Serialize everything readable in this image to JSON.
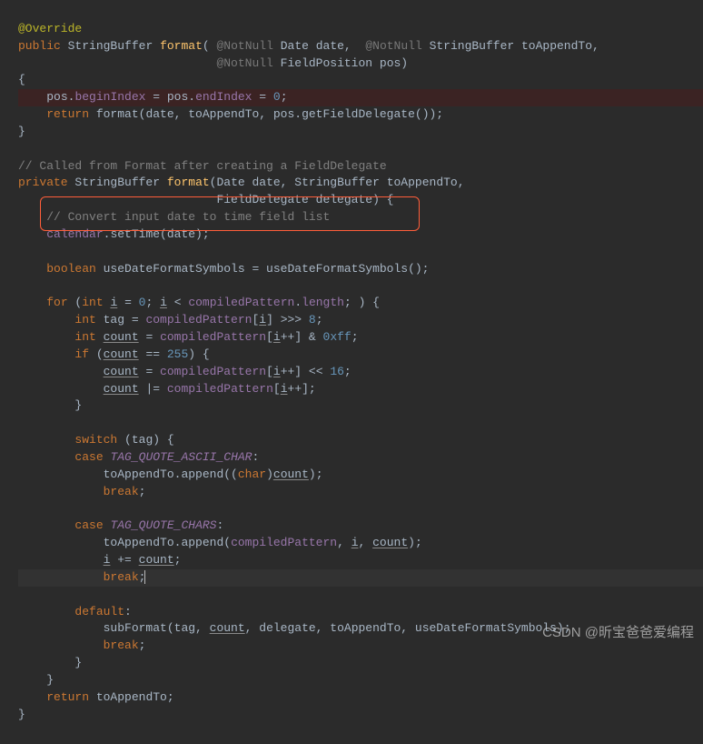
{
  "code": {
    "l1_ann": "@Override",
    "l2_kw1": "public",
    "l2_type1": "StringBuffer",
    "l2_method": "format",
    "l2_p_hint1": "@NotNull",
    "l2_p1": "Date date,",
    "l2_p_hint2": "@NotNull",
    "l2_p2": "StringBuffer toAppendTo,",
    "l3_p_hint": "@NotNull",
    "l3_p": "FieldPosition pos)",
    "l4": "{",
    "l5_a": "pos.",
    "l5_b": "beginIndex",
    "l5_c": " = pos.",
    "l5_d": "endIndex",
    "l5_e": " = ",
    "l5_num": "0",
    "l5_f": ";",
    "l6_kw": "return",
    "l6_a": " format(date, toAppendTo, pos.getFieldDelegate());",
    "l7": "}",
    "l9_comment": "// Called from Format after creating a FieldDelegate",
    "l10_kw": "private",
    "l10_type": "StringBuffer",
    "l10_method": "format",
    "l10_params": "(Date date, StringBuffer toAppendTo,",
    "l11_params": "FieldDelegate delegate) {",
    "l12_comment": "// Convert input date to time field list",
    "l13_a": "calendar",
    "l13_b": ".setTime(date);",
    "l15_kw": "boolean",
    "l15_a": " useDateFormatSymbols = useDateFormatSymbols();",
    "l17_kw": "for",
    "l17_a": " (",
    "l17_kw2": "int",
    "l17_i": "i",
    "l17_b": " = ",
    "l17_n0": "0",
    "l17_c": "; ",
    "l17_i2": "i",
    "l17_d": " < ",
    "l17_cp": "compiledPattern",
    "l17_e": ".",
    "l17_len": "length",
    "l17_f": "; ) {",
    "l18_kw": "int",
    "l18_a": " tag = ",
    "l18_cp": "compiledPattern",
    "l18_b": "[",
    "l18_i": "i",
    "l18_c": "] >>> ",
    "l18_n": "8",
    "l18_d": ";",
    "l19_kw": "int",
    "l19_count": "count",
    "l19_a": " = ",
    "l19_cp": "compiledPattern",
    "l19_b": "[",
    "l19_i": "i",
    "l19_c": "++] & ",
    "l19_n": "0xff",
    "l19_d": ";",
    "l20_kw": "if",
    "l20_a": " (",
    "l20_count": "count",
    "l20_b": " == ",
    "l20_n": "255",
    "l20_c": ") {",
    "l21_count": "count",
    "l21_a": " = ",
    "l21_cp": "compiledPattern",
    "l21_b": "[",
    "l21_i": "i",
    "l21_c": "++] << ",
    "l21_n": "16",
    "l21_d": ";",
    "l22_count": "count",
    "l22_a": " |= ",
    "l22_cp": "compiledPattern",
    "l22_b": "[",
    "l22_i": "i",
    "l22_c": "++];",
    "l23": "}",
    "l25_kw": "switch",
    "l25_a": " (tag) {",
    "l26_kw": "case",
    "l26_const": "TAG_QUOTE_ASCII_CHAR",
    "l26_a": ":",
    "l27_a": "toAppendTo.append((",
    "l27_kw": "char",
    "l27_b": ")",
    "l27_count": "count",
    "l27_c": ");",
    "l28_kw": "break",
    "l28_a": ";",
    "l30_kw": "case",
    "l30_const": "TAG_QUOTE_CHARS",
    "l30_a": ":",
    "l31_a": "toAppendTo.append(",
    "l31_cp": "compiledPattern",
    "l31_b": ", ",
    "l31_i": "i",
    "l31_c": ", ",
    "l31_count": "count",
    "l31_d": ");",
    "l32_i": "i",
    "l32_a": " += ",
    "l32_count": "count",
    "l32_b": ";",
    "l33_kw": "break",
    "l33_a": ";",
    "l35_kw": "default",
    "l35_a": ":",
    "l36_a": "subFormat(tag, ",
    "l36_count": "count",
    "l36_b": ", delegate, toAppendTo, useDateFormatSymbols);",
    "l37_kw": "break",
    "l37_a": ";",
    "l38": "}",
    "l39": "}",
    "l40_kw": "return",
    "l40_a": " toAppendTo;",
    "l41": "}"
  },
  "watermark": "CSDN @昕宝爸爸爱编程"
}
